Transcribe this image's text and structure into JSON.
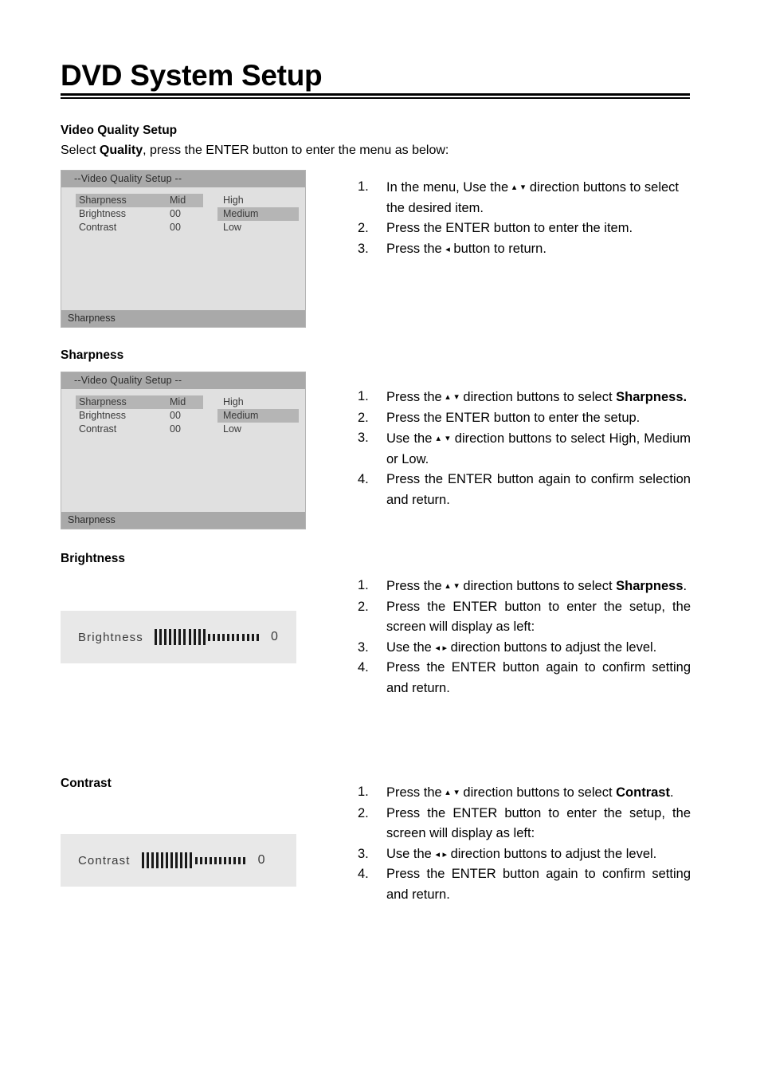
{
  "document": {
    "title": "DVD System Setup"
  },
  "video_quality_setup": {
    "heading": "Video Quality Setup",
    "intro_before": "Select ",
    "intro_bold": "Quality",
    "intro_after": ", press the ENTER button to enter the menu as below:",
    "steps": [
      {
        "num": "1.",
        "pre": "In the menu, Use the ",
        "arrows": "▴ ▾",
        "post": " direction buttons to select the desired item."
      },
      {
        "num": "2.",
        "pre": "Press the ENTER button to enter the item.",
        "arrows": "",
        "post": ""
      },
      {
        "num": "3.",
        "pre": "Press the ",
        "arrows": "◂",
        "post": " button to return."
      }
    ]
  },
  "osd_menu": {
    "title": "--Video  Quality Setup --",
    "status": "Sharpness",
    "rows": [
      {
        "label": "Sharpness",
        "value": "Mid",
        "option": "High",
        "left_highlight": true,
        "right_highlight": false
      },
      {
        "label": "Brightness",
        "value": "00",
        "option": "Medium",
        "left_highlight": false,
        "right_highlight": true
      },
      {
        "label": "Contrast",
        "value": "00",
        "option": "Low",
        "left_highlight": false,
        "right_highlight": false
      }
    ]
  },
  "sharpness": {
    "heading": "Sharpness",
    "steps": [
      {
        "num": "1.",
        "pre": "Press the ",
        "arrows": "▴ ▾",
        "mid": " direction buttons to select ",
        "bold": "Sharpness.",
        "post": ""
      },
      {
        "num": "2.",
        "pre": "Press the ENTER button to enter the setup.",
        "arrows": "",
        "mid": "",
        "bold": "",
        "post": ""
      },
      {
        "num": "3.",
        "pre": "Use the ",
        "arrows": "▴ ▾",
        "mid": " direction buttons to select High, Medium or Low.",
        "bold": "",
        "post": ""
      },
      {
        "num": "4.",
        "pre": "Press the ENTER button again to confirm selection and return.",
        "arrows": "",
        "mid": "",
        "bold": "",
        "post": ""
      }
    ]
  },
  "brightness": {
    "heading": "Brightness",
    "slider": {
      "label": "Brightness",
      "value": "0",
      "filled_ticks": 11,
      "empty_ticks": 11,
      "total_ticks": 22
    },
    "steps": [
      {
        "num": "1.",
        "pre": "Press the ",
        "arrows": "▴ ▾",
        "mid": " direction buttons to select ",
        "bold": "Sharpness",
        "post": "."
      },
      {
        "num": "2.",
        "pre": "Press the ENTER button to enter the setup, the screen will display as left:",
        "arrows": "",
        "mid": "",
        "bold": "",
        "post": ""
      },
      {
        "num": "3.",
        "pre": "Use the ",
        "arrows": "◂ ▸",
        "mid": " direction buttons to adjust the level.",
        "bold": "",
        "post": ""
      },
      {
        "num": "4.",
        "pre": "Press the ENTER button again to confirm setting and return.",
        "arrows": "",
        "mid": "",
        "bold": "",
        "post": ""
      }
    ]
  },
  "contrast": {
    "heading": "Contrast",
    "slider": {
      "label": "Contrast",
      "value": "0",
      "filled_ticks": 11,
      "empty_ticks": 11,
      "total_ticks": 22
    },
    "steps": [
      {
        "num": "1.",
        "pre": "Press the ",
        "arrows": "▴ ▾",
        "mid": " direction buttons to select ",
        "bold": "Contrast",
        "post": "."
      },
      {
        "num": "2.",
        "pre": "Press the ENTER button to enter the setup, the screen will display as left:",
        "arrows": "",
        "mid": "",
        "bold": "",
        "post": ""
      },
      {
        "num": "3.",
        "pre": "Use the ",
        "arrows": "◂ ▸",
        "mid": " direction buttons to adjust the level.",
        "bold": "",
        "post": ""
      },
      {
        "num": "4.",
        "pre": "Press the ENTER button again to confirm setting and return.",
        "arrows": "",
        "mid": "",
        "bold": "",
        "post": ""
      }
    ]
  },
  "colors": {
    "osd_title_bar": "#a9a9a9",
    "osd_body": "#e0e0e0",
    "osd_highlight": "#b5b5b5",
    "slider_background": "#e8e8e8",
    "text": "#000000"
  }
}
